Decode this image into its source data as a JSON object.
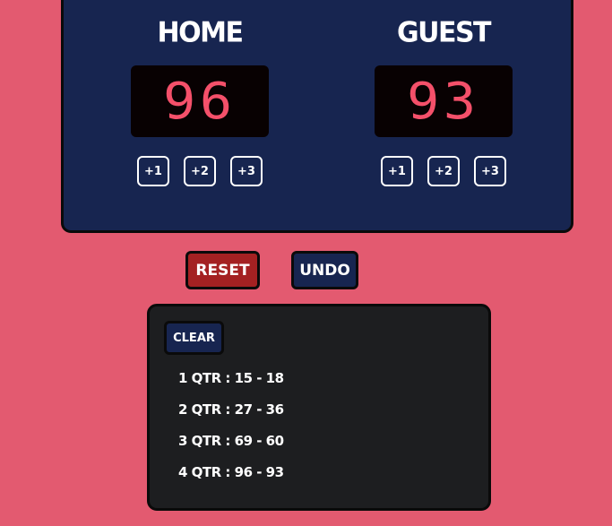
{
  "scoreboard": {
    "home": {
      "name": "HOME",
      "score": "96",
      "buttons": [
        "+1",
        "+2",
        "+3"
      ]
    },
    "guest": {
      "name": "GUEST",
      "score": "93",
      "buttons": [
        "+1",
        "+2",
        "+3"
      ]
    }
  },
  "actions": {
    "reset_label": "RESET",
    "undo_label": "UNDO"
  },
  "history": {
    "clear_label": "CLEAR",
    "quarters": [
      "1 QTR : 15 - 18",
      "2 QTR : 27 - 36",
      "3 QTR : 69 - 60",
      "4 QTR : 96 - 93"
    ]
  },
  "colors": {
    "page_background": "#e35a70",
    "board_background": "#172550",
    "score_digits": "#f4506a",
    "reset_button": "#a42122",
    "history_background": "#1d1e20"
  }
}
